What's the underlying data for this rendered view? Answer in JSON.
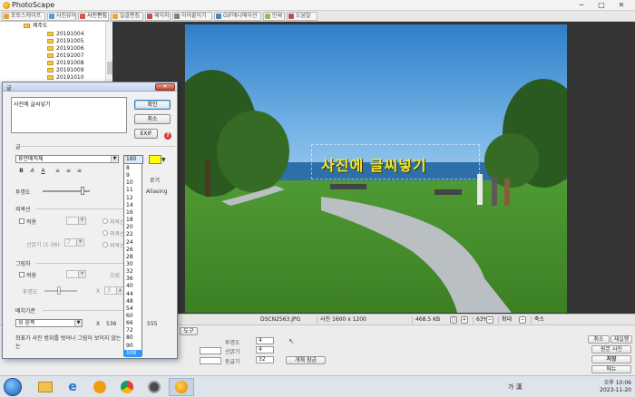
{
  "app": {
    "title": "PhotoScape"
  },
  "tabs": [
    {
      "label": "포토스케이프",
      "color": "#e3a23a",
      "active": false
    },
    {
      "label": "사진뷰어",
      "color": "#5b9bd5",
      "active": false
    },
    {
      "label": "사진편집",
      "color": "#d9534f",
      "active": true
    },
    {
      "label": "일괄편집",
      "color": "#e8a838",
      "active": false
    },
    {
      "label": "페이지",
      "color": "#c0504d",
      "active": false
    },
    {
      "label": "이어붙이기",
      "color": "#7f7f7f",
      "active": false
    },
    {
      "label": "GIF애니메이션",
      "color": "#4f81bd",
      "active": false
    },
    {
      "label": "인쇄",
      "color": "#9bbb59",
      "active": false
    },
    {
      "label": "도움말",
      "color": "#c0504d",
      "active": false
    }
  ],
  "tree": {
    "parent": "제주도",
    "folders": [
      "20191004",
      "20191005",
      "20191006",
      "20191007",
      "20191008",
      "20191009",
      "20191010"
    ]
  },
  "photo": {
    "caption": "사진에 글씨넣기"
  },
  "status": {
    "filename": "DSCN2563.JPG",
    "dimensions": "사진 1600 x 1200",
    "filesize": "468.5 KB",
    "zoom": "63%",
    "zoom_in": "확대",
    "zoom_out": "축소",
    "mode": "도구"
  },
  "dialog": {
    "title": "글",
    "text_value": "사진에 글씨넣기",
    "ok": "확인",
    "cancel": "취소",
    "exif": "EXIF",
    "section_text": "글",
    "font_name": "휴먼매직체",
    "size_value": "180",
    "opacity_label": "투명도",
    "antialias_label": "Aliasing",
    "outline_section": "외곽선",
    "outline_apply": "적용",
    "outline_thickness": "선굵기 (1-36)",
    "outline_thickness_value": "7",
    "outline_radio_1": "외곽선",
    "outline_radio_2": "외곽선",
    "outline_radio_3": "외곽선",
    "shadow_section": "그림자",
    "shadow_apply": "적용",
    "shadow_opacity": "투명도",
    "shadow_x_label": "X",
    "shadow_x_value": "3",
    "shadow_blur_label": "흐림",
    "anchor_section": "배치기준",
    "anchor_value": "위 왼쪽",
    "anchor_x_label": "X",
    "anchor_x_value": "536",
    "anchor_y_value": "555",
    "note": "좌표가 사진 범위를 벗어나 그림이 보이지 않는",
    "note_cont": "는",
    "style_bold": "B",
    "style_italic": "A",
    "style_underline": "A",
    "align_left": "≡",
    "align_center": "≡",
    "align_right": "≡",
    "color_label": "색",
    "color_value": "#ffff00",
    "font_shadow_label": "로기"
  },
  "size_options": [
    "8",
    "9",
    "10",
    "11",
    "12",
    "14",
    "16",
    "18",
    "20",
    "22",
    "24",
    "26",
    "28",
    "30",
    "32",
    "36",
    "40",
    "44",
    "48",
    "54",
    "60",
    "66",
    "72",
    "80",
    "90",
    "100"
  ],
  "size_selected": "100",
  "bottom": {
    "tool_label": "도구",
    "bright_label": "투명도",
    "bright_value": "4",
    "thick_label": "선굵기",
    "thick_value": "4",
    "round_label": "둥글기",
    "round_value": "32",
    "obj_btn": "개체 잠금",
    "undo": "취소",
    "redo": "재실행",
    "original": "원본 사진",
    "save": "저장",
    "menu": "메뉴",
    "bottom_text": "는"
  },
  "taskbar": {
    "ime": "가 漢",
    "time_line1": "오후 10:06",
    "time_line2": "2023-11-20"
  }
}
